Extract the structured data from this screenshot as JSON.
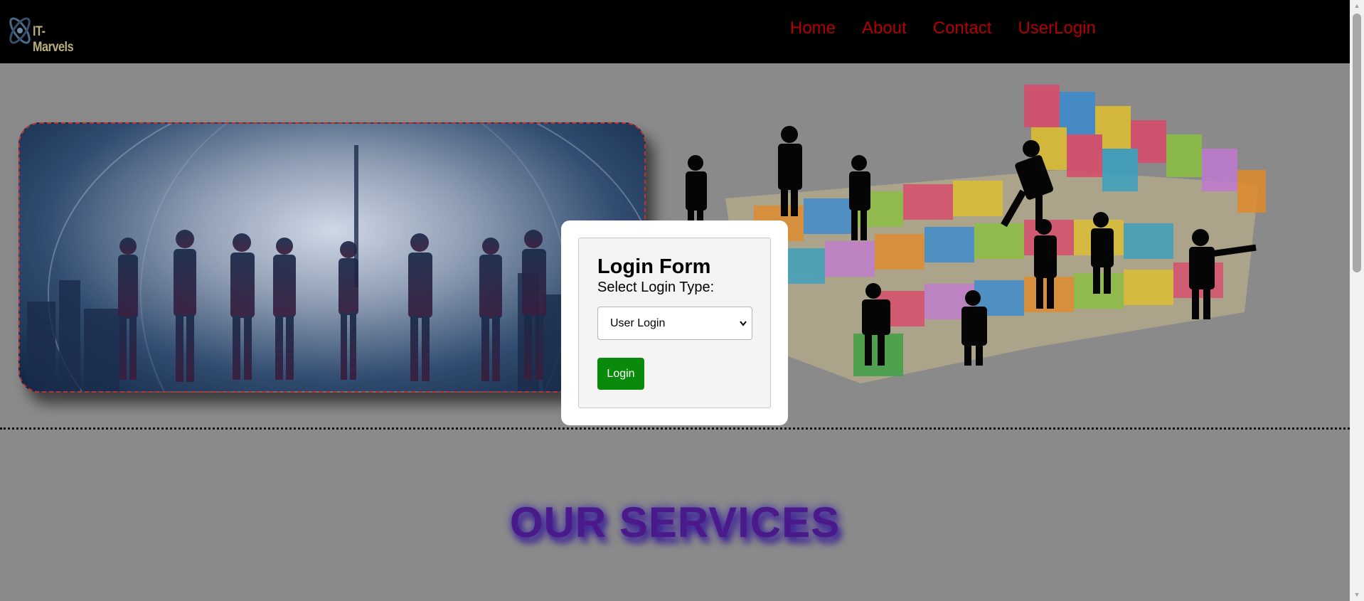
{
  "logo": {
    "text": "IT-Marvels"
  },
  "nav": {
    "items": [
      {
        "label": "Home"
      },
      {
        "label": "About"
      },
      {
        "label": "Contact"
      },
      {
        "label": "UserLogin"
      }
    ]
  },
  "login": {
    "title": "Login Form",
    "select_label": "Select Login Type:",
    "selected_option": "User Login",
    "button_label": "Login"
  },
  "services": {
    "heading": "OUR SERVICES"
  },
  "colors": {
    "nav_bg": "#000000",
    "nav_link": "#b30000",
    "login_button": "#0a8a0a",
    "services_heading": "#4b1a8a"
  }
}
